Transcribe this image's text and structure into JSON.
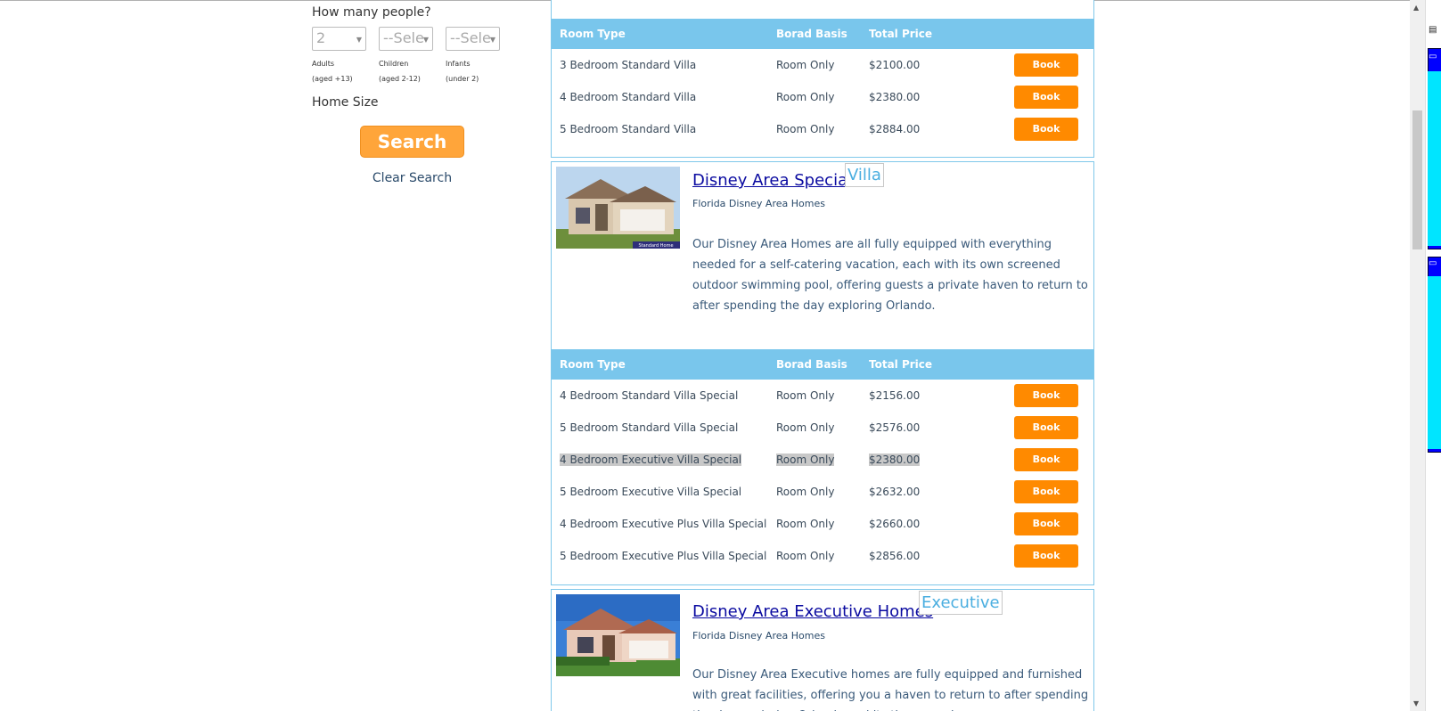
{
  "sidebar": {
    "people_title": "How many people?",
    "adults": {
      "value": "2",
      "label": "Adults",
      "sub": "(aged +13)"
    },
    "children": {
      "value": "--Sele",
      "label": "Children",
      "sub": "(aged 2-12)"
    },
    "infants": {
      "value": "--Sele",
      "label": "Infants",
      "sub": "(under 2)"
    },
    "home_size_label": "Home Size",
    "search_label": "Search",
    "clear_label": "Clear Search"
  },
  "table_headers": {
    "room_type": "Room Type",
    "board_basis": "Borad Basis",
    "total_price": "Total Price"
  },
  "book_label": "Book",
  "panel1": {
    "rows": [
      {
        "room": "3 Bedroom Standard Villa",
        "basis": "Room Only",
        "price": "$2100.00"
      },
      {
        "room": "4 Bedroom Standard Villa",
        "basis": "Room Only",
        "price": "$2380.00"
      },
      {
        "room": "5 Bedroom Standard Villa",
        "basis": "Room Only",
        "price": "$2884.00"
      }
    ]
  },
  "panel2": {
    "title": "Disney Area Special",
    "badge_alt": "Villa",
    "subtitle": "Florida Disney Area Homes",
    "thumb_caption": "Standard Home",
    "description": "Our Disney Area Homes are all fully equipped with everything needed for a self-catering vacation, each with its own screened outdoor swimming pool, offering guests a private haven to return to after spending the day exploring Orlando.",
    "rows": [
      {
        "room": "4 Bedroom Standard Villa Special",
        "basis": "Room Only",
        "price": "$2156.00"
      },
      {
        "room": "5 Bedroom Standard Villa Special",
        "basis": "Room Only",
        "price": "$2576.00"
      },
      {
        "room": "4 Bedroom Executive Villa Special",
        "basis": "Room Only",
        "price": "$2380.00"
      },
      {
        "room": "5 Bedroom Executive Villa Special",
        "basis": "Room Only",
        "price": "$2632.00"
      },
      {
        "room": "4 Bedroom Executive Plus Villa Special",
        "basis": "Room Only",
        "price": "$2660.00"
      },
      {
        "room": "5 Bedroom Executive Plus Villa Special",
        "basis": "Room Only",
        "price": "$2856.00"
      }
    ]
  },
  "panel3": {
    "title": "Disney Area Executive Homes",
    "badge_alt": "Executive",
    "subtitle": "Florida Disney Area Homes",
    "description": "Our Disney Area Executive homes are fully equipped and furnished with great facilities, offering you a haven to return to after spending the day exploring Orlando and its theme parks."
  }
}
